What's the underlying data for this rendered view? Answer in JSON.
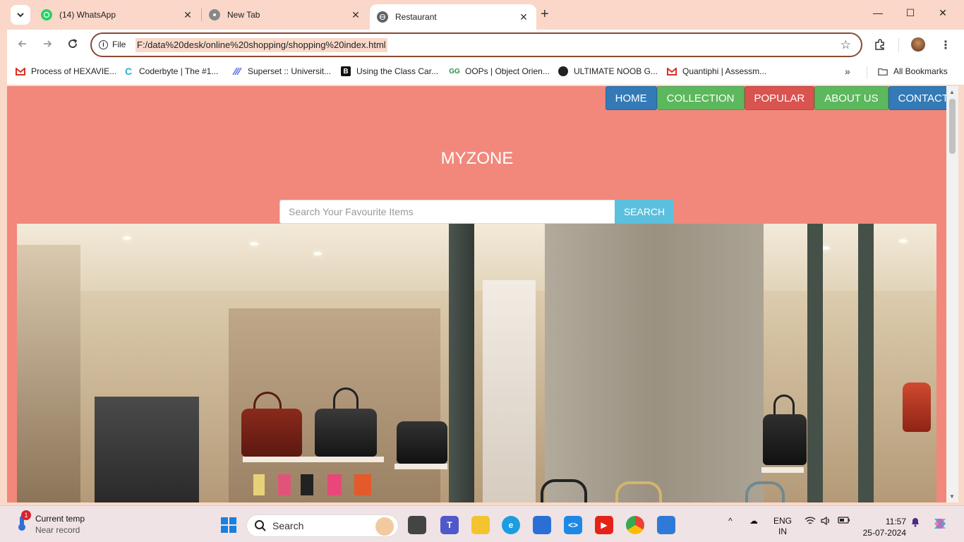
{
  "browser": {
    "tabs": [
      {
        "label": "(14) WhatsApp",
        "icon": "whatsapp-icon"
      },
      {
        "label": "New Tab",
        "icon": "chrome-icon"
      },
      {
        "label": "Restaurant",
        "icon": "globe-icon",
        "active": true
      }
    ],
    "close_glyph": "✕",
    "new_tab_glyph": "+",
    "window_controls": {
      "minimize": "—",
      "maximize": "☐",
      "close": "✕"
    },
    "omnibox": {
      "scheme_label": "File",
      "url": "F:/data%20desk/online%20shopping/shopping%20index.html"
    },
    "bookmarks": [
      {
        "label": "Process of HEXAVIE...",
        "icon": "gmail-icon"
      },
      {
        "label": "Coderbyte | The #1...",
        "icon": "coderbyte-icon"
      },
      {
        "label": "Superset :: Universit...",
        "icon": "superset-icon"
      },
      {
        "label": "Using the Class Car...",
        "icon": "bookmark-b-icon"
      },
      {
        "label": "OOPs | Object Orien...",
        "icon": "gfg-icon"
      },
      {
        "label": "ULTIMATE NOOB G...",
        "icon": "globe-icon"
      },
      {
        "label": "Quantiphi | Assessm...",
        "icon": "gmail-icon"
      }
    ],
    "bookmarks_more": "»",
    "all_bookmarks": "All Bookmarks"
  },
  "page": {
    "nav": [
      "HOME",
      "COLLECTION",
      "POPULAR",
      "ABOUT US",
      "CONTACT"
    ],
    "brand": "MYZONE",
    "search_placeholder": "Search Your Favourite Items",
    "search_button": "SEARCH",
    "hero_image": "store-interior-handbags"
  },
  "taskbar": {
    "weather_title": "Current temp",
    "weather_sub": "Near record",
    "weather_badge": "1",
    "search_label": "Search",
    "lang_line1": "ENG",
    "lang_line2": "IN",
    "time": "11:57",
    "date": "25-07-2024"
  },
  "colors": {
    "page_bg": "#f1887b",
    "home": "#337ab7",
    "collection": "#5cb85c",
    "popular": "#d9534f",
    "about": "#5cb85c",
    "contact": "#337ab7",
    "search_button": "#5bc0de"
  }
}
